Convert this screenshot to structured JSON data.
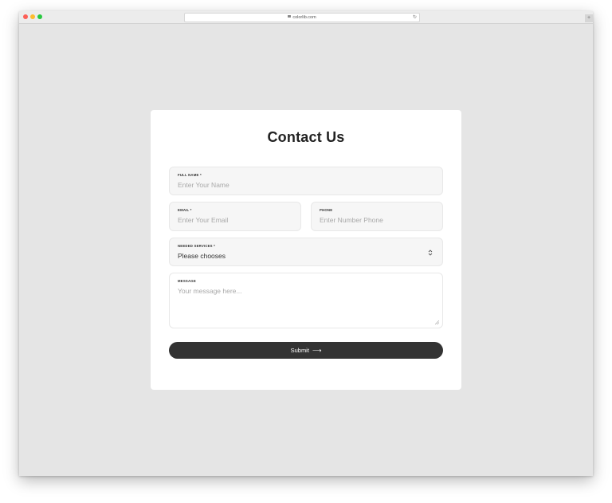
{
  "browser": {
    "url": "colorlib.com"
  },
  "form": {
    "title": "Contact Us",
    "full_name": {
      "label": "FULL NAME *",
      "placeholder": "Enter Your Name"
    },
    "email": {
      "label": "EMAIL *",
      "placeholder": "Enter Your Email"
    },
    "phone": {
      "label": "PHONE",
      "placeholder": "Enter Number Phone"
    },
    "services": {
      "label": "NEEDED SERVICES *",
      "selected": "Please chooses"
    },
    "message": {
      "label": "MESSAGE",
      "placeholder": "Your message here..."
    },
    "submit_label": "Submit",
    "submit_icon": "⟶"
  },
  "colors": {
    "page_background": "#e5e5e5",
    "card_background": "#ffffff",
    "field_background": "#f6f6f6",
    "button_background": "#333333",
    "button_text": "#ffffff",
    "title_text": "#222222",
    "placeholder_text": "#a8a8a8"
  },
  "icons": {
    "lock": "lock-icon",
    "reload": "reload-icon",
    "select_arrows": "select-arrows-icon",
    "submit_arrow": "arrow-right-icon"
  }
}
